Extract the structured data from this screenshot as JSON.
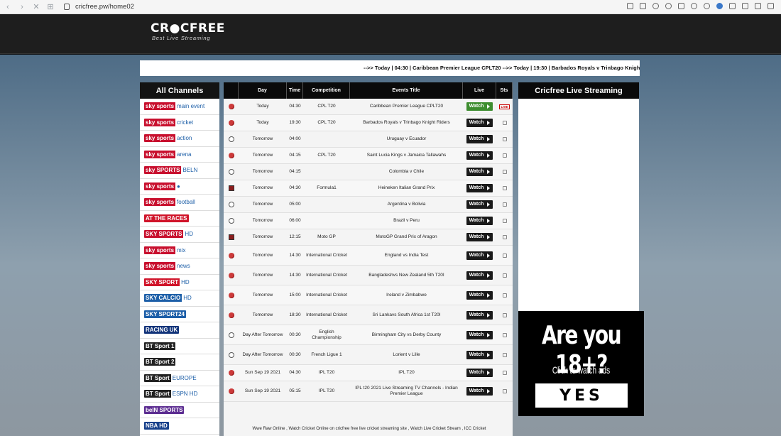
{
  "browser": {
    "url": "cricfree.pw/home02"
  },
  "site": {
    "logo_main": "CR●CFREE",
    "logo_tagline": "Best Live Streaming"
  },
  "ticker": "-->> Today | 04:30 | Caribbean Premier League CPLT20 -->> Today | 19:30 | Barbados Royals v Trinbago Knight Riders -->> To",
  "channels": {
    "heading": "All Channels",
    "items": [
      {
        "a": "sky sports",
        "b": "main event",
        "color": "#c8102e"
      },
      {
        "a": "sky sports",
        "b": "cricket",
        "color": "#c8102e"
      },
      {
        "a": "sky sports",
        "b": "action",
        "color": "#c8102e"
      },
      {
        "a": "sky sports",
        "b": "arena",
        "color": "#c8102e"
      },
      {
        "a": "sky SPORTS",
        "b": "BELN",
        "color": "#c8102e"
      },
      {
        "a": "sky sports",
        "b": "●",
        "color": "#c8102e"
      },
      {
        "a": "sky sports",
        "b": "football",
        "color": "#c8102e"
      },
      {
        "a": "AT THE RACES",
        "b": "",
        "color": "#d0142a"
      },
      {
        "a": "SKY SPORTS",
        "b": "HD",
        "color": "#c8102e"
      },
      {
        "a": "sky sports",
        "b": "mix",
        "color": "#c8102e"
      },
      {
        "a": "sky sports",
        "b": "news",
        "color": "#c8102e"
      },
      {
        "a": "SKY SPORT",
        "b": "HD",
        "color": "#d0142a"
      },
      {
        "a": "SKY CALCIO",
        "b": "HD",
        "color": "#1d5fa8"
      },
      {
        "a": "SKY SPORT24",
        "b": "",
        "color": "#1d5fa8"
      },
      {
        "a": "RACING UK",
        "b": "",
        "color": "#12347a"
      },
      {
        "a": "BT Sport 1",
        "b": "",
        "color": "#222222"
      },
      {
        "a": "BT Sport 2",
        "b": "",
        "color": "#222222"
      },
      {
        "a": "BT Sport",
        "b": "EUROPE",
        "color": "#222222"
      },
      {
        "a": "BT Sport",
        "b": "ESPN HD",
        "color": "#222222"
      },
      {
        "a": "beIN SPORTS",
        "b": "",
        "color": "#5c2d91"
      },
      {
        "a": "NBA HD",
        "b": "",
        "color": "#17408b"
      }
    ]
  },
  "table": {
    "headers": [
      "",
      "Day",
      "Time",
      "Competition",
      "Events Title",
      "Live",
      "Sts"
    ],
    "watch_label": "Watch",
    "rows": [
      {
        "icon": "cricket-ball",
        "day": "Today",
        "time": "04:30",
        "comp": "CPL T20",
        "title": "Caribbean Premier League CPLT20",
        "live": true
      },
      {
        "icon": "cricket-ball",
        "day": "Today",
        "time": "19:30",
        "comp": "CPL T20",
        "title": "Barbados Royals v Trinbago Knight Riders",
        "live": false
      },
      {
        "icon": "soccer-ball",
        "day": "Tomorrow",
        "time": "04:00",
        "comp": "",
        "title": "Uruguay v Ecuador",
        "live": false
      },
      {
        "icon": "cricket-ball",
        "day": "Tomorrow",
        "time": "04:15",
        "comp": "CPL T20",
        "title": "Saint Lucia Kings v Jamaica Tallawahs",
        "live": false
      },
      {
        "icon": "soccer-ball",
        "day": "Tomorrow",
        "time": "04:15",
        "comp": "",
        "title": "Colombia v Chile",
        "live": false
      },
      {
        "icon": "motorsport",
        "day": "Tomorrow",
        "time": "04:30",
        "comp": "Formula1",
        "title": "Heineken Italian Grand Prix",
        "live": false
      },
      {
        "icon": "soccer-ball",
        "day": "Tomorrow",
        "time": "05:00",
        "comp": "",
        "title": "Argentina v Bolivia",
        "live": false
      },
      {
        "icon": "soccer-ball",
        "day": "Tomorrow",
        "time": "06:00",
        "comp": "",
        "title": "Brazil v Peru",
        "live": false
      },
      {
        "icon": "motorsport",
        "day": "Tomorrow",
        "time": "12:15",
        "comp": "Moto GP",
        "title": "MotoGP Grand Prix of Aragon",
        "live": false
      },
      {
        "icon": "cricket-ball",
        "day": "Tomorrow",
        "time": "14:30",
        "comp": "International Cricket",
        "title": "England vs India Test",
        "live": false
      },
      {
        "icon": "cricket-ball",
        "day": "Tomorrow",
        "time": "14:30",
        "comp": "International Cricket",
        "title": "Bangladeshvs New Zealand 5th T20I",
        "live": false
      },
      {
        "icon": "cricket-ball",
        "day": "Tomorrow",
        "time": "15:00",
        "comp": "International Cricket",
        "title": "Ireland v Zimbabwe",
        "live": false
      },
      {
        "icon": "cricket-ball",
        "day": "Tomorrow",
        "time": "18:30",
        "comp": "International Cricket",
        "title": "Sri Lankavs South Africa 1st T20I",
        "live": false
      },
      {
        "icon": "soccer-ball",
        "day": "Day After Tomorrow",
        "time": "00:30",
        "comp": "English Championship",
        "title": "Birmingham City vs Derby County",
        "live": false
      },
      {
        "icon": "soccer-ball",
        "day": "Day After Tomorrow",
        "time": "00:30",
        "comp": "French Ligue 1",
        "title": "Lorient v Lille",
        "live": false
      },
      {
        "icon": "cricket-ball",
        "day": "Sun Sep 19 2021",
        "time": "04:30",
        "comp": "IPL T20",
        "title": "IPL T20",
        "live": false
      },
      {
        "icon": "cricket-ball",
        "day": "Sun Sep 19 2021",
        "time": "05:15",
        "comp": "IPL T20",
        "title": "IPL t20 2021 Live Streaming TV Channels - Indian Premier League",
        "live": false
      }
    ],
    "footer": "Wwe Raw Online , Watch Cricket Online on cricfree free live cricket streaming site , Watch Live Cricket Stream , ICC Cricket"
  },
  "stream_panel": {
    "heading": "Cricfree Live Streaming"
  },
  "ad": {
    "question": "Are you 18+?",
    "subtitle": "Click to watch ads",
    "button": "YES"
  }
}
